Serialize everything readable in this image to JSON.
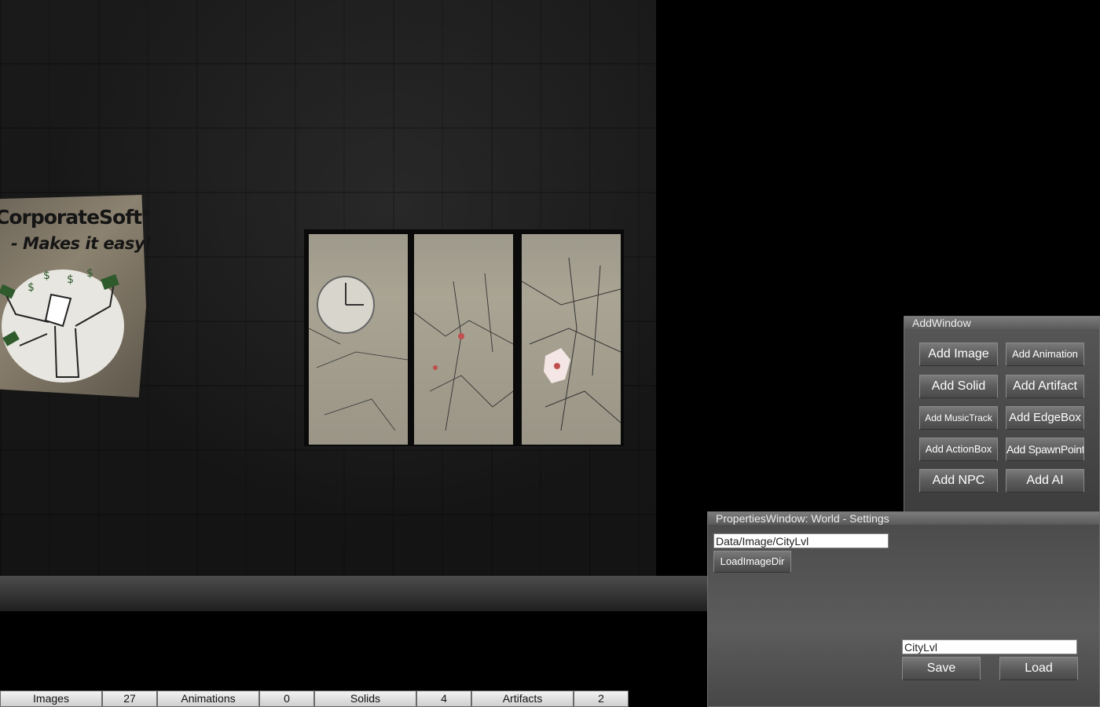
{
  "scene": {
    "poster": {
      "title": "CorporateSoft",
      "trademark": "©",
      "tagline": "- Makes it easy!"
    }
  },
  "add_window": {
    "title": "AddWindow",
    "buttons": [
      "Add Image",
      "Add Animation",
      "Add Solid",
      "Add Artifact",
      "Add MusicTrack",
      "Add EdgeBox",
      "Add ActionBox",
      "Add SpawnPoint",
      "Add NPC",
      "Add AI"
    ]
  },
  "properties_window": {
    "title": "PropertiesWindow: World - Settings",
    "image_dir_value": "Data/Image/CityLvl",
    "load_image_dir_label": "LoadImageDir",
    "level_name_value": "CityLvl",
    "save_label": "Save",
    "load_label": "Load"
  },
  "stats": [
    {
      "label": "Images",
      "value": "27"
    },
    {
      "label": "Animations",
      "value": "0"
    },
    {
      "label": "Solids",
      "value": "4"
    },
    {
      "label": "Artifacts",
      "value": "2"
    }
  ]
}
